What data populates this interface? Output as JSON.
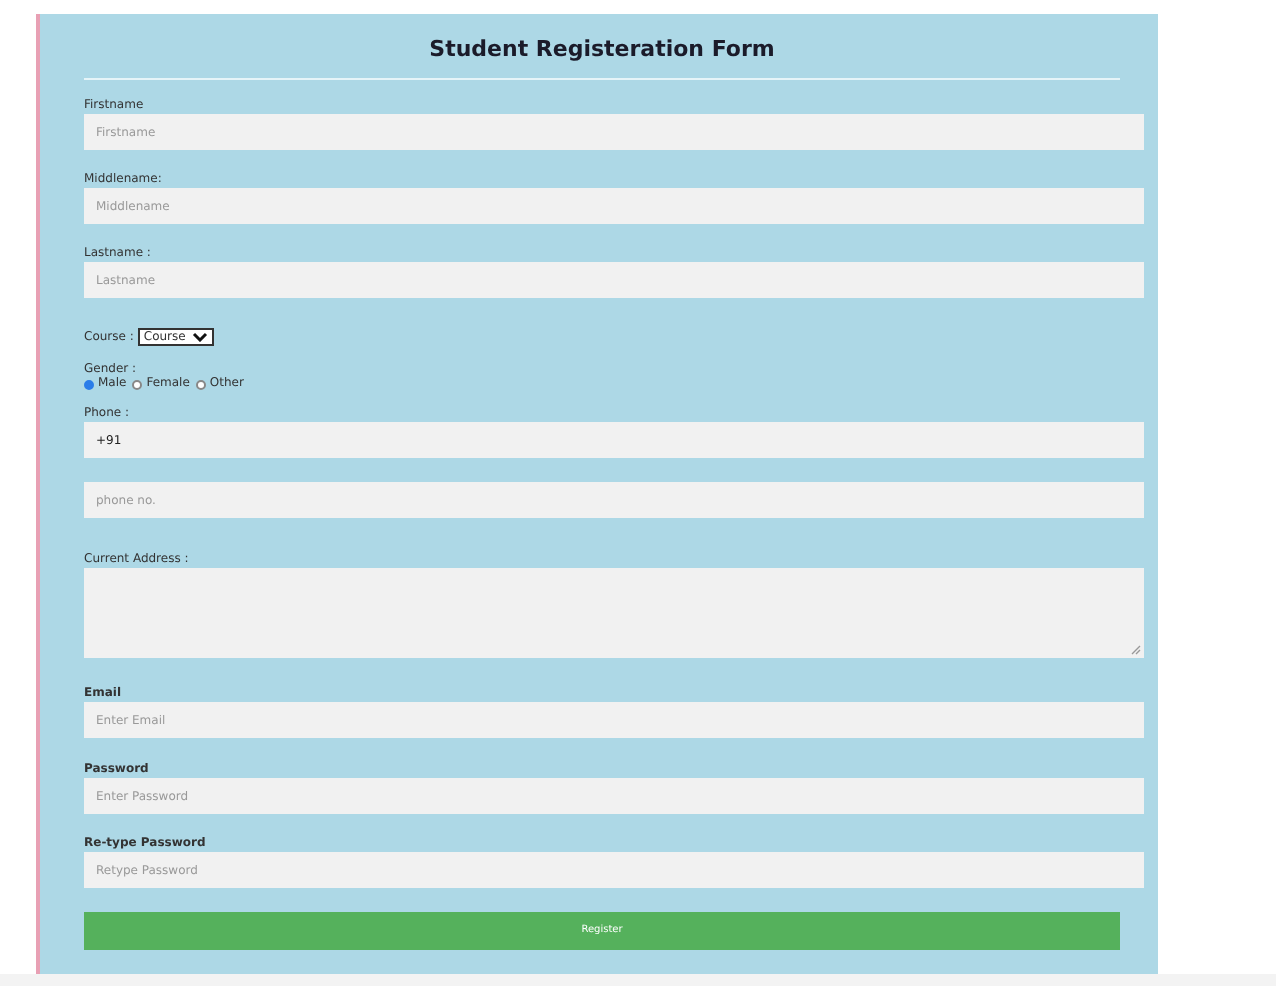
{
  "title": "Student Registeration Form",
  "items": [
    {
      "kind": "text",
      "label": "Firstname",
      "bold": false,
      "placeholder": "Firstname"
    },
    {
      "kind": "text",
      "label": "Middlename:",
      "bold": false,
      "placeholder": "Middlename"
    },
    {
      "kind": "text",
      "label": "Lastname :",
      "bold": false,
      "placeholder": "Lastname"
    },
    {
      "kind": "select",
      "label": "Course :",
      "value": "Course"
    },
    {
      "kind": "radio",
      "label": "Gender :",
      "options": [
        {
          "label": "Male",
          "selected": true
        },
        {
          "label": "Female",
          "selected": false
        },
        {
          "label": "Other",
          "selected": false
        }
      ]
    },
    {
      "kind": "text",
      "label": "Phone :",
      "bold": false,
      "value": "+91"
    },
    {
      "kind": "text",
      "placeholder": "phone no."
    },
    {
      "kind": "textarea",
      "label": "Current Address :"
    },
    {
      "kind": "text",
      "label": "Email",
      "bold": true,
      "placeholder": "Enter Email"
    },
    {
      "kind": "text",
      "label": "Password",
      "bold": true,
      "placeholder": "Enter Password"
    },
    {
      "kind": "text",
      "label": "Re-type Password",
      "bold": true,
      "placeholder": "Retype Password"
    },
    {
      "kind": "button",
      "label": "Register"
    }
  ]
}
